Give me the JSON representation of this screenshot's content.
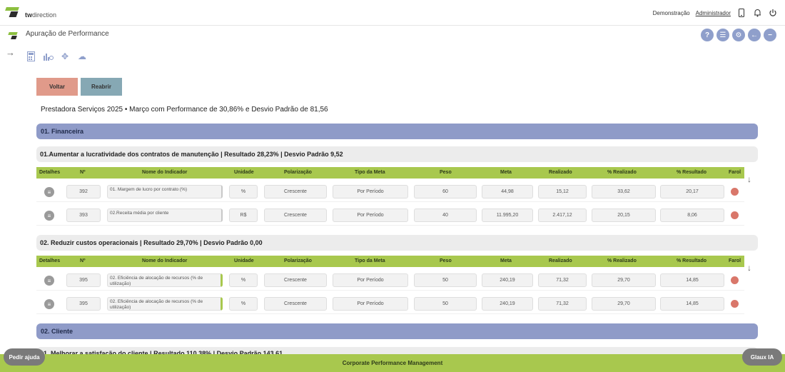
{
  "brand": {
    "logo_text_bold": "tw",
    "logo_text": "direction"
  },
  "topbar": {
    "user_mode": "Demonstração",
    "user": "Administrador"
  },
  "page": {
    "title": "Apuração de Performance"
  },
  "actions": {
    "back_label": "Voltar",
    "reopen_label": "Reabrir"
  },
  "summary": "Prestadora Serviços 2025 • Março com Performance de 30,86% e Desvio Padrão de 81,56",
  "columns": [
    "Detalhes",
    "Nº",
    "Nome do Indicador",
    "Unidade",
    "Polarização",
    "Tipo da Meta",
    "Peso",
    "Meta",
    "Realizado",
    "% Realizado",
    "% Resultado",
    "Farol"
  ],
  "sections": [
    {
      "title": "01. Financeira",
      "objectives": [
        {
          "title": "01.Aumentar a lucratividade dos contratos de manutenção | Resultado 28,23% | Desvio Padrão 9,52",
          "rows": [
            {
              "num": "392",
              "name": "01. Margem de lucro por contrato (%)",
              "unit": "%",
              "polarization": "Crescente",
              "goal_type": "Por Período",
              "weight": "60",
              "goal": "44,98",
              "actual": "15,12",
              "pct_actual": "33,62",
              "pct_result": "20,17",
              "light_color": "#d9776a"
            },
            {
              "num": "393",
              "name": "02.Receita média por cliente",
              "unit": "R$",
              "polarization": "Crescente",
              "goal_type": "Por Período",
              "weight": "40",
              "goal": "11.995,20",
              "actual": "2.417,12",
              "pct_actual": "20,15",
              "pct_result": "8,06",
              "light_color": "#d9776a"
            }
          ]
        },
        {
          "title": "02. Reduzir custos operacionais | Resultado 29,70% | Desvio Padrão 0,00",
          "rows": [
            {
              "num": "395",
              "name": "02. Eficiência de alocação de recursos (% de utilização)",
              "unit": "%",
              "polarization": "Crescente",
              "goal_type": "Por Período",
              "weight": "50",
              "goal": "240,19",
              "actual": "71,32",
              "pct_actual": "29,70",
              "pct_result": "14,85",
              "light_color": "#d9776a"
            },
            {
              "num": "395",
              "name": "02. Eficiência de alocação de recursos (% de utilização)",
              "unit": "%",
              "polarization": "Crescente",
              "goal_type": "Por Período",
              "weight": "50",
              "goal": "240,19",
              "actual": "71,32",
              "pct_actual": "29,70",
              "pct_result": "14,85",
              "light_color": "#d9776a"
            }
          ]
        }
      ]
    },
    {
      "title": "02. Cliente",
      "objectives": [
        {
          "title": "01. Melhorar a satisfação do cliente | Resultado 110,38% | Desvio Padrão 143,61",
          "rows": []
        }
      ]
    }
  ],
  "footer": {
    "text": "Corporate Performance Management",
    "help_label": "Pedir ajuda",
    "ai_label": "Glaux IA"
  },
  "icons": {
    "round": [
      "help-icon",
      "list-icon",
      "settings-icon",
      "back-icon",
      "minus-icon"
    ],
    "tools": [
      "calculator-icon",
      "chart-icon",
      "move-icon",
      "cloud-icon"
    ],
    "top": [
      "phone-icon",
      "bell-icon",
      "power-icon"
    ]
  },
  "colors": {
    "accent": "#a8c84e",
    "section": "#8f9bc8",
    "farol_red": "#d9776a"
  }
}
